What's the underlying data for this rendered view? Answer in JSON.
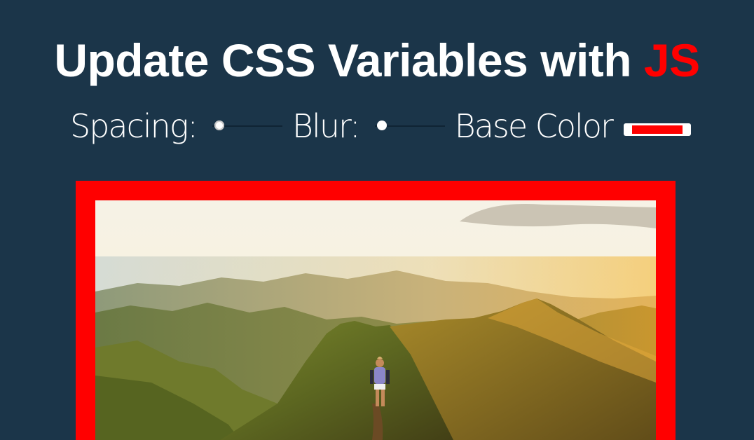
{
  "header": {
    "title_main": "Update CSS Variables with ",
    "title_accent": "JS"
  },
  "controls": {
    "spacing": {
      "label": "Spacing:",
      "value_fraction": 0.1
    },
    "blur": {
      "label": "Blur:",
      "value_fraction": 0.1
    },
    "base_color": {
      "label": "Base Color",
      "value": "#ff0000"
    }
  },
  "colors": {
    "background": "#1b3549",
    "accent": "#ff0000"
  },
  "image": {
    "description_icon": "mountain-hiker-photo"
  }
}
